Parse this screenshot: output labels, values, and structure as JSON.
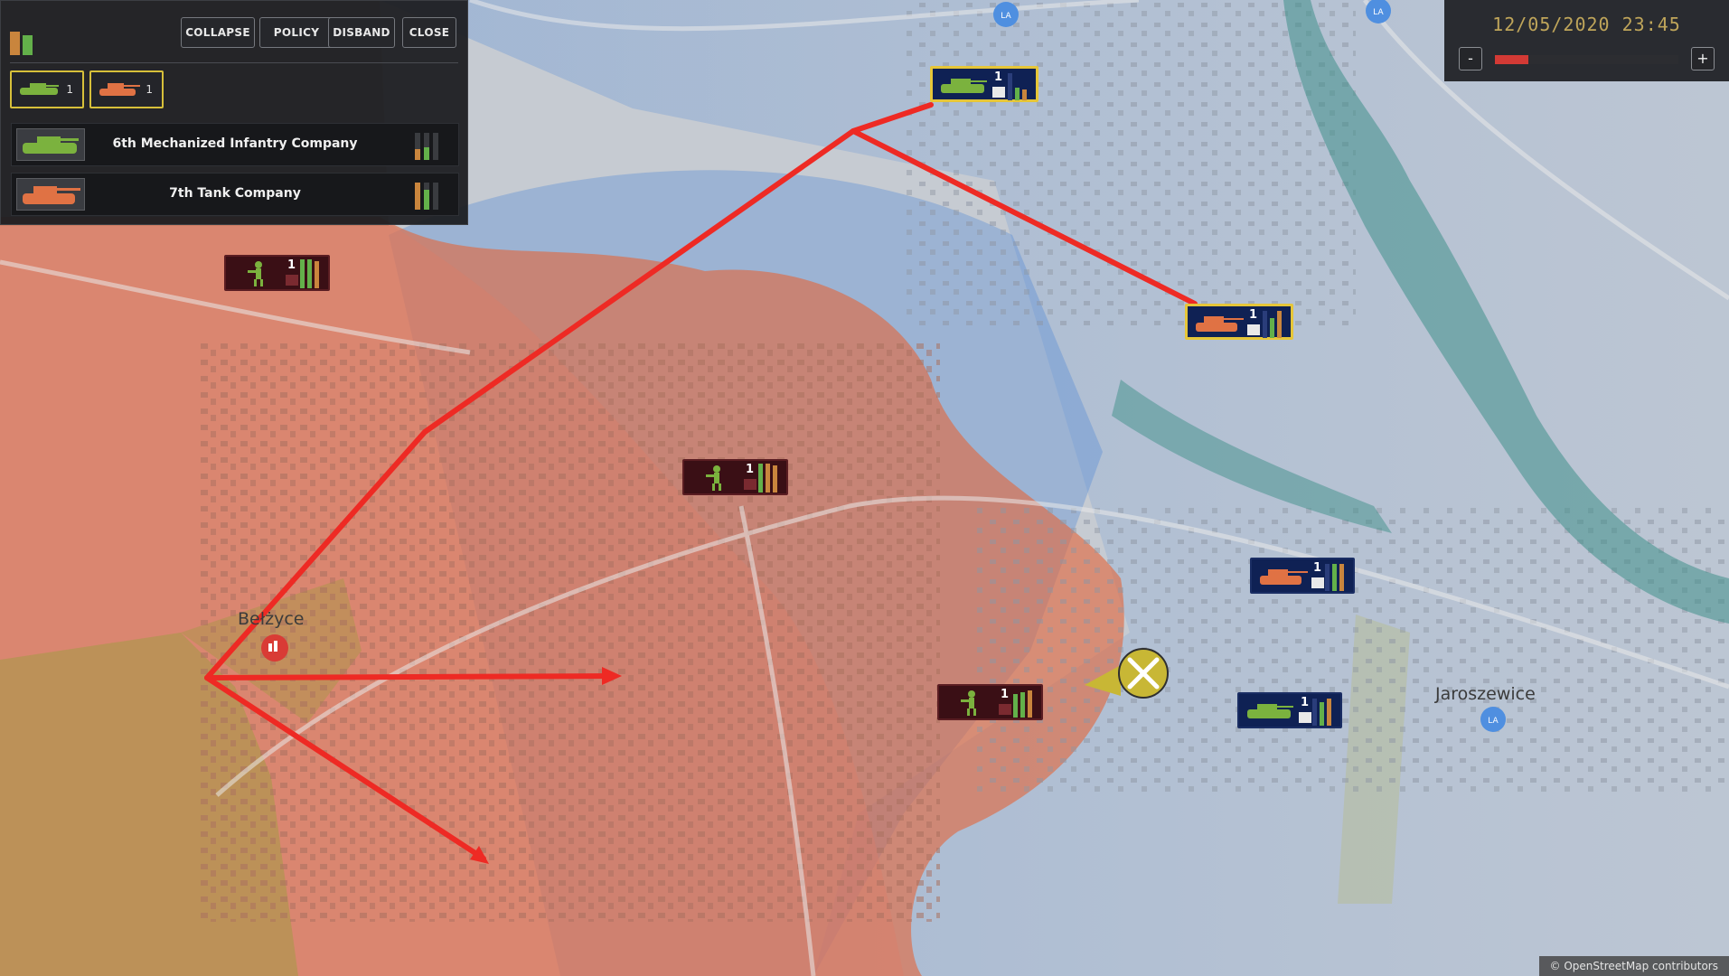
{
  "window": {
    "datetime": "12/05/2020 23:45",
    "zoom_out_label": "-",
    "zoom_in_label": "+",
    "time_progress": 0.18
  },
  "group_panel": {
    "buttons": {
      "collapse": "COLLAPSE",
      "policy": "POLICY",
      "disband": "DISBAND",
      "close": "CLOSE"
    },
    "type_counts": [
      {
        "type": "ifv-icon",
        "count": "1",
        "color": "#7bb23e"
      },
      {
        "type": "tank-icon",
        "count": "1",
        "color": "#e07244"
      }
    ],
    "units": [
      {
        "name": "6th Mechanized Infantry Company",
        "icon": "ifv-icon"
      },
      {
        "name": "7th Tank Company",
        "icon": "tank-icon"
      }
    ]
  },
  "map": {
    "towns": [
      "Bełżyce",
      "Jaroszewice"
    ],
    "attribution": "© OpenStreetMap contributors",
    "colors": {
      "friendly_zone": "#4f8fe0",
      "enemy_zone": "#e8663c",
      "route": "#ee2a24",
      "selection": "#e6c638",
      "friendly_counter": "#0f2154",
      "enemy_counter": "#3a0f15"
    }
  },
  "counters": [
    {
      "id": "friendly-ifv-north",
      "side": "friendly",
      "unit": "ifv-icon",
      "count": "1",
      "selected": true
    },
    {
      "id": "friendly-tank-east",
      "side": "friendly",
      "unit": "tank-icon",
      "count": "1",
      "selected": true
    },
    {
      "id": "friendly-tank-reserve",
      "side": "friendly",
      "unit": "tank-icon",
      "count": "1",
      "selected": false
    },
    {
      "id": "friendly-ifv-reserve",
      "side": "friendly",
      "unit": "ifv-icon",
      "count": "1",
      "selected": false
    },
    {
      "id": "enemy-infantry-northwest",
      "side": "enemy",
      "unit": "infantry-icon",
      "count": "1"
    },
    {
      "id": "enemy-infantry-center",
      "side": "enemy",
      "unit": "infantry-icon",
      "count": "1"
    },
    {
      "id": "enemy-infantry-east",
      "side": "enemy",
      "unit": "infantry-icon",
      "count": "1"
    }
  ]
}
